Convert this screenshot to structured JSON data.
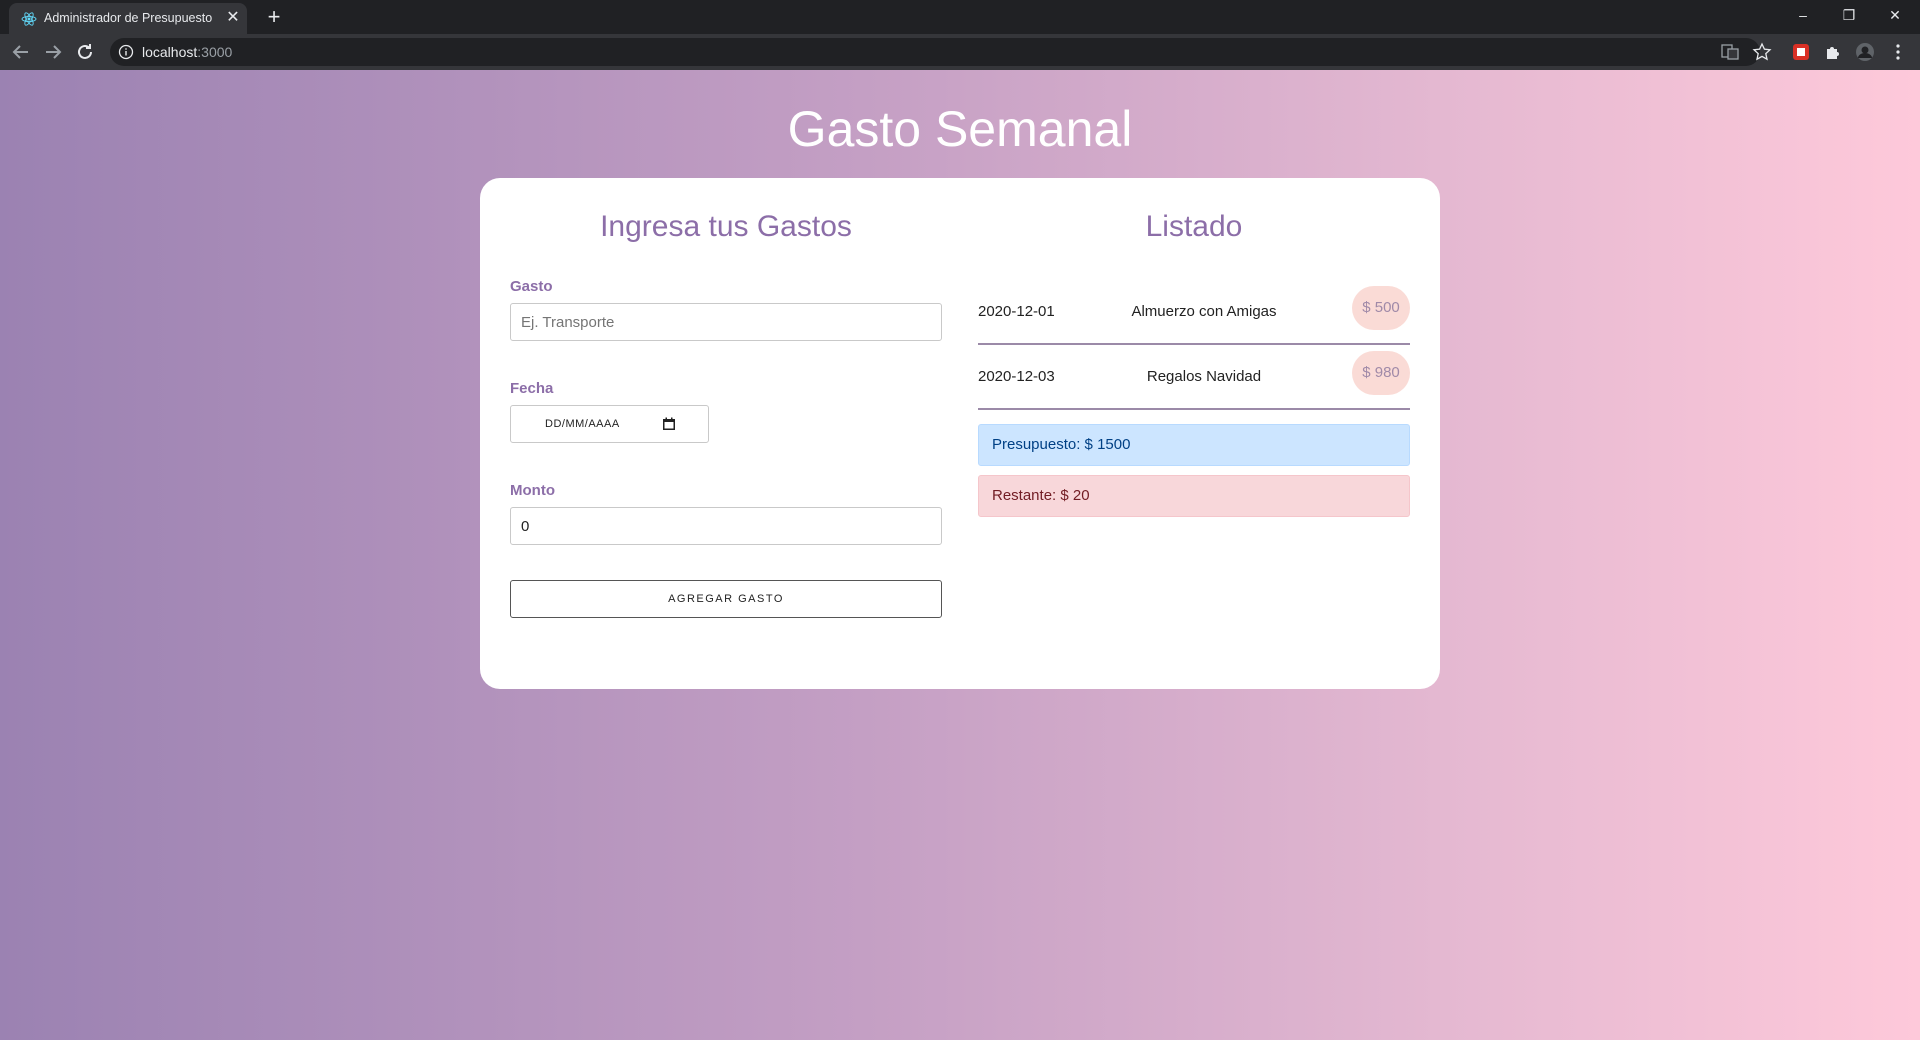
{
  "browser": {
    "tab_title": "Administrador de Presupuesto",
    "url_host": "localhost",
    "url_port": ":3000",
    "icons": [
      "react-favicon-icon",
      "close-icon",
      "new-tab-icon",
      "back-icon",
      "forward-icon",
      "reload-icon",
      "info-icon",
      "translate-icon",
      "star-icon",
      "extension-icon",
      "puzzle-icon",
      "profile-avatar",
      "menu-icon",
      "minimize-icon",
      "restore-icon",
      "window-close-icon"
    ]
  },
  "page": {
    "title": "Gasto Semanal"
  },
  "form": {
    "heading": "Ingresa tus Gastos",
    "gasto_label": "Gasto",
    "gasto_placeholder": "Ej. Transporte",
    "fecha_label": "Fecha",
    "fecha_value": "DD/MM/AAAA",
    "monto_label": "Monto",
    "monto_value": "0",
    "submit_label": "AGREGAR GASTO"
  },
  "listado": {
    "heading": "Listado",
    "items": [
      {
        "date": "2020-12-01",
        "name": "Almuerzo con Amigas",
        "amount": "$ 500"
      },
      {
        "date": "2020-12-03",
        "name": "Regalos Navidad",
        "amount": "$ 980"
      }
    ],
    "presupuesto": "Presupuesto: $ 1500",
    "restante": "Restante: $ 20"
  },
  "colors": {
    "accent": "#8c6ea8",
    "gradient_start": "#9b82b2",
    "gradient_end": "#fec9da",
    "amount_badge": "#fadbd6",
    "alert_primary": "#cce5ff",
    "alert_danger": "#f8d7da"
  }
}
